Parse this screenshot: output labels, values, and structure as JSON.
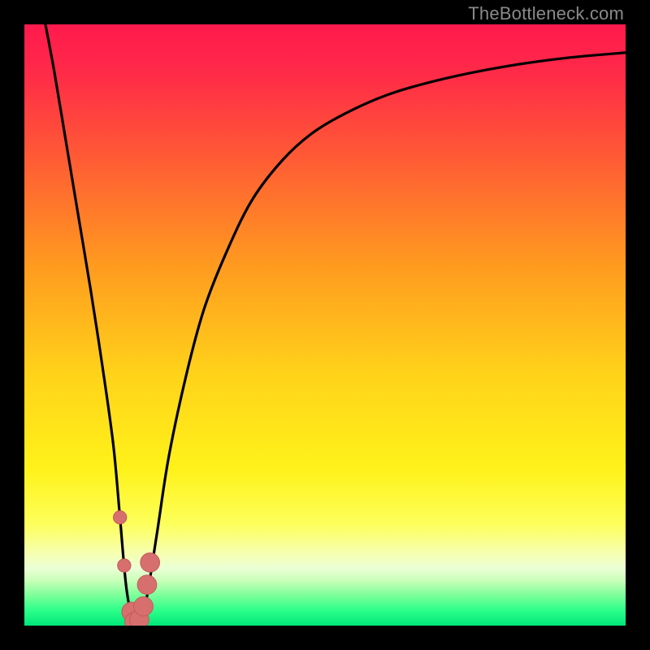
{
  "watermark": "TheBottleneck.com",
  "colors": {
    "black": "#000000",
    "curve": "#000000",
    "dot_fill": "#d76f6f",
    "dot_stroke": "#c35a5a",
    "gradient_stops": [
      {
        "offset": 0.0,
        "color": "#ff1a4d"
      },
      {
        "offset": 0.08,
        "color": "#ff2a48"
      },
      {
        "offset": 0.22,
        "color": "#ff5a35"
      },
      {
        "offset": 0.4,
        "color": "#ff9a1f"
      },
      {
        "offset": 0.58,
        "color": "#ffd21a"
      },
      {
        "offset": 0.74,
        "color": "#fff21a"
      },
      {
        "offset": 0.83,
        "color": "#fdff5a"
      },
      {
        "offset": 0.88,
        "color": "#f6ffb0"
      },
      {
        "offset": 0.905,
        "color": "#eaffd6"
      },
      {
        "offset": 0.925,
        "color": "#c9ffb8"
      },
      {
        "offset": 0.95,
        "color": "#7bff9a"
      },
      {
        "offset": 0.975,
        "color": "#2bff8a"
      },
      {
        "offset": 1.0,
        "color": "#00e67a"
      }
    ]
  },
  "chart_data": {
    "type": "line",
    "title": "",
    "xlabel": "",
    "ylabel": "",
    "xlim": [
      0,
      100
    ],
    "ylim": [
      0,
      100
    ],
    "series": [
      {
        "name": "bottleneck-curve",
        "x": [
          3.5,
          5,
          7,
          9,
          11,
          13,
          14.8,
          15.9,
          17,
          18.3,
          20,
          22,
          24,
          27,
          30,
          34,
          38,
          43,
          48,
          54,
          61,
          70,
          80,
          90,
          100
        ],
        "y": [
          100,
          92,
          80,
          68,
          56,
          43,
          30,
          18,
          6,
          0.5,
          3,
          15,
          28,
          42,
          53,
          63,
          71,
          77.5,
          82,
          85.5,
          88.5,
          91,
          93,
          94.4,
          95.3
        ]
      }
    ],
    "min_point": {
      "x": 18.3,
      "y": 0.5
    },
    "data_points": [
      {
        "x": 15.9,
        "y": 18,
        "r": 1.1
      },
      {
        "x": 16.6,
        "y": 10,
        "r": 1.1
      },
      {
        "x": 17.8,
        "y": 2.3,
        "r": 1.6
      },
      {
        "x": 18.3,
        "y": 0.6,
        "r": 1.6
      },
      {
        "x": 19.1,
        "y": 1.0,
        "r": 1.6
      },
      {
        "x": 19.8,
        "y": 3.2,
        "r": 1.6
      },
      {
        "x": 20.4,
        "y": 6.8,
        "r": 1.6
      },
      {
        "x": 20.9,
        "y": 10.5,
        "r": 1.6
      }
    ]
  }
}
